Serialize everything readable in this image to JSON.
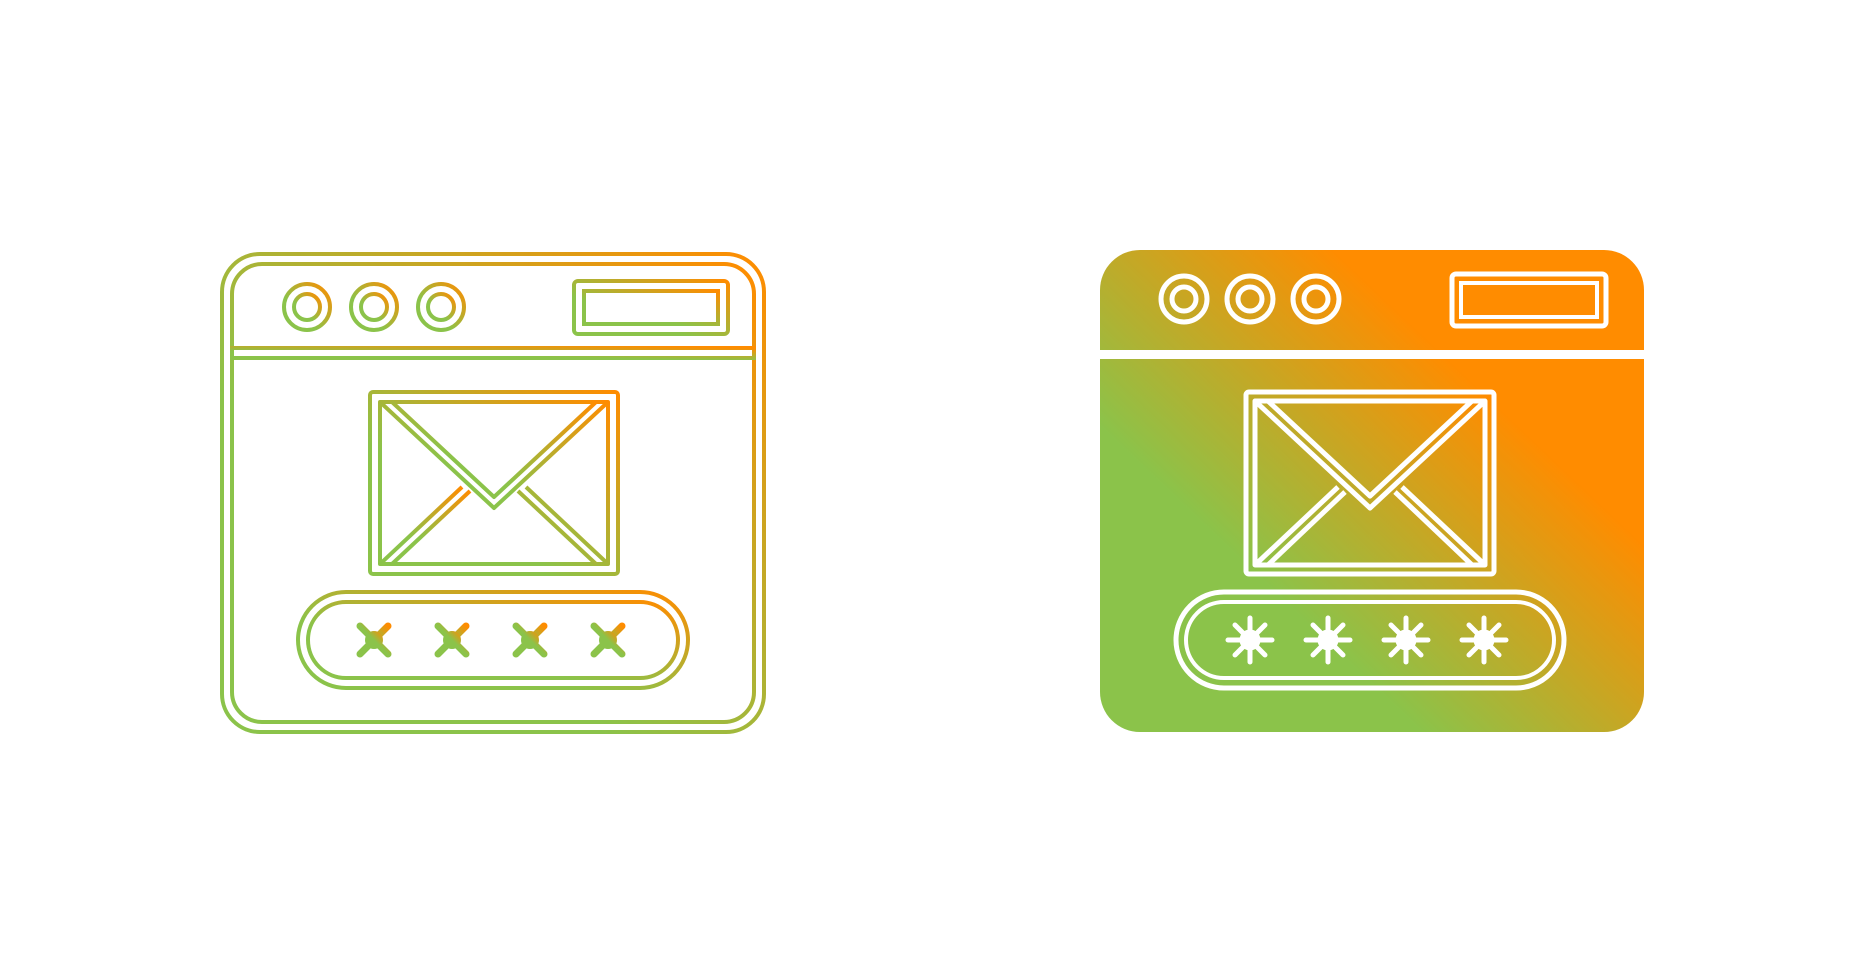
{
  "colors": {
    "background": "#ffffff",
    "gradient_green": "#8bc34a",
    "gradient_orange": "#ff8c00",
    "inner_stroke": "#ffffff"
  },
  "icons": [
    {
      "name": "email-password-login-outline-icon",
      "style": "outline"
    },
    {
      "name": "email-password-login-glyph-icon",
      "style": "glyph"
    }
  ],
  "password_mask": {
    "glyph": "asterisk-icon",
    "count": 4
  }
}
